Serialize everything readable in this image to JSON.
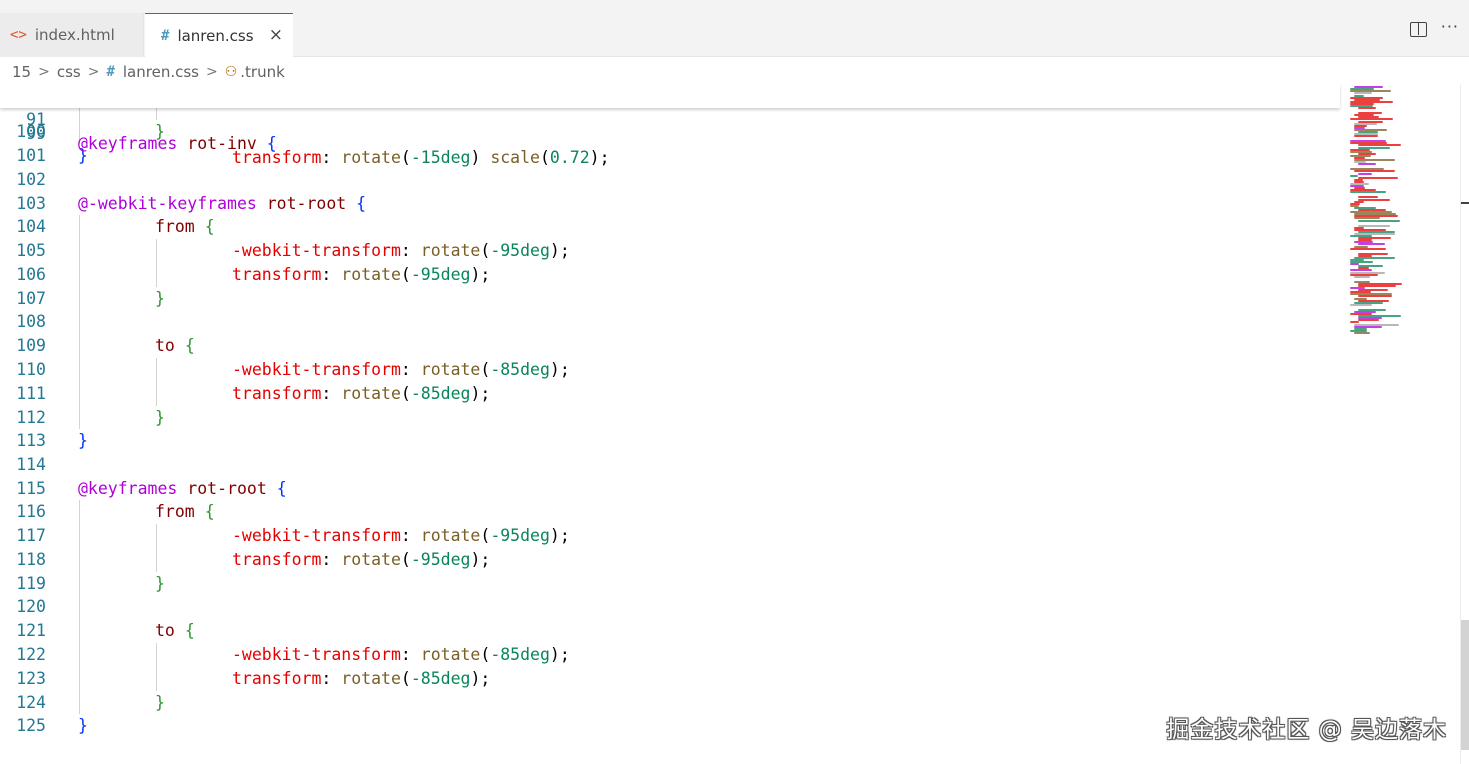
{
  "tabs": [
    {
      "label": "index.html",
      "icon": "html-file-icon",
      "active": false
    },
    {
      "label": "lanren.css",
      "icon": "css-file-icon",
      "active": true,
      "close": "×"
    }
  ],
  "tab_actions": {
    "split": "split-editor-icon",
    "more": "···"
  },
  "breadcrumb": {
    "num": "15",
    "folder": "css",
    "file": "lanren.css",
    "symbol": ".trunk"
  },
  "sticky": {
    "line": "91",
    "text": "@keyframes rot-inv {",
    "under_line": "99",
    "under_text": "transform: rotate(-15deg) scale(0.72);"
  },
  "lines": [
    {
      "n": "100"
    },
    {
      "n": "101"
    },
    {
      "n": "102"
    },
    {
      "n": "103"
    },
    {
      "n": "104"
    },
    {
      "n": "105"
    },
    {
      "n": "106"
    },
    {
      "n": "107"
    },
    {
      "n": "108"
    },
    {
      "n": "109"
    },
    {
      "n": "110"
    },
    {
      "n": "111"
    },
    {
      "n": "112"
    },
    {
      "n": "113"
    },
    {
      "n": "114"
    },
    {
      "n": "115"
    },
    {
      "n": "116"
    },
    {
      "n": "117"
    },
    {
      "n": "118"
    },
    {
      "n": "119"
    },
    {
      "n": "120"
    },
    {
      "n": "121"
    },
    {
      "n": "122"
    },
    {
      "n": "123"
    },
    {
      "n": "124"
    },
    {
      "n": "125"
    }
  ],
  "code": {
    "kf1": "@-webkit-keyframes",
    "name1": "rot-root",
    "kf2": "@keyframes",
    "name2": "rot-root",
    "kf0": "@keyframes",
    "name0": "rot-inv",
    "from": "from",
    "to": "to",
    "wt": "-webkit-transform",
    "t": "transform",
    "rotate": "rotate",
    "v95": "-95deg",
    "v85": "-85deg",
    "v15": "-15deg",
    "scale": "scale",
    "v072": "0.72"
  },
  "watermark": "掘金技术社区 @ 吴边落木",
  "colors": {
    "keyword_at": "#af00db",
    "property": "#e50000",
    "number": "#098658",
    "function": "#795e26",
    "line_number": "#237893",
    "active_tab_border": "#1a73c8"
  }
}
